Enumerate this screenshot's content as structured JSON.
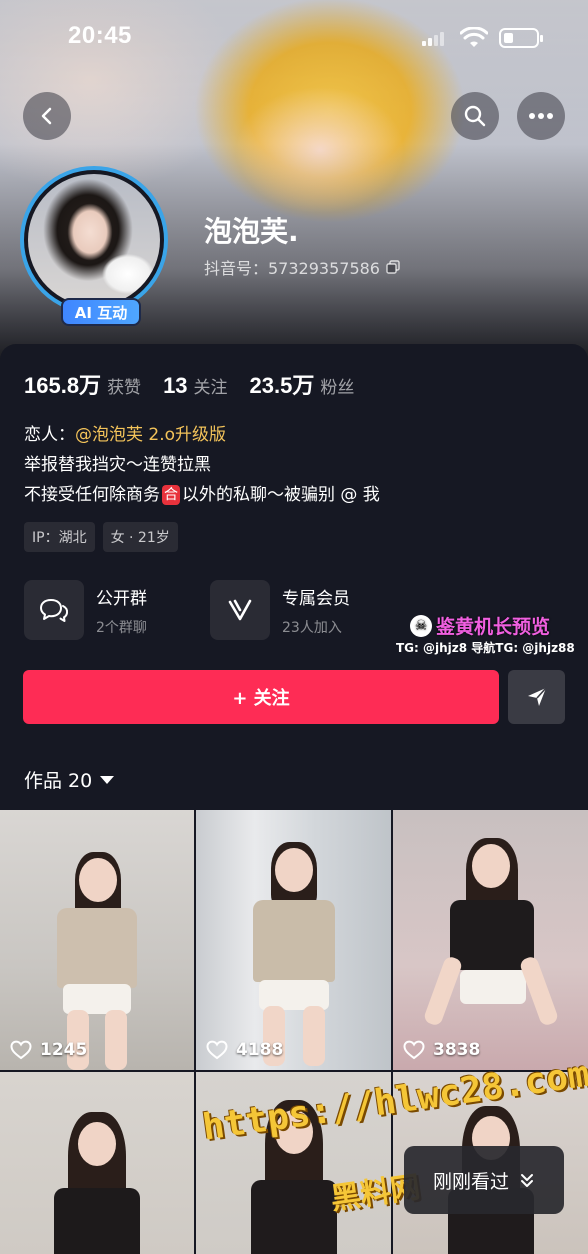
{
  "status_bar": {
    "time": "20:45"
  },
  "profile": {
    "nickname": "泡泡芙.",
    "douyin_id": "抖音号：57329357586",
    "ai_badge": "AI 互动"
  },
  "stats": [
    {
      "value": "165.8万",
      "label": "获赞"
    },
    {
      "value": "13",
      "label": "关注"
    },
    {
      "value": "23.5万",
      "label": "粉丝"
    }
  ],
  "bio": {
    "lover_label": "恋人：",
    "lover_mention": "@泡泡芙 2.o升级版",
    "line2": "举报替我挡灾～连赞拉黑",
    "line3_a": "不接受任何除商务",
    "line3_badge": "合",
    "line3_b": "以外的私聊～被骗别 @ 我"
  },
  "tags": [
    "IP：湖北",
    "女 · 21岁"
  ],
  "entries": [
    {
      "title": "公开群",
      "sub": "2个群聊",
      "icon": "chat-bubbles-icon"
    },
    {
      "title": "专属会员",
      "sub": "23人加入",
      "icon": "vip-v-icon"
    }
  ],
  "watermark": {
    "brand": "鉴黄机长预览",
    "tg": "TG: @jhjz8 导航TG: @jhjz88",
    "url": "https://hlwc28.com",
    "site": "黑料网"
  },
  "actions": {
    "follow": "+ 关注"
  },
  "works_tab": {
    "label": "作品 20"
  },
  "videos": [
    {
      "likes": "1245"
    },
    {
      "likes": "4188"
    },
    {
      "likes": "3838"
    }
  ],
  "recent_pill": {
    "label": "刚刚看过"
  },
  "colors": {
    "follow": "#fe2c55",
    "mention": "#f3c35a",
    "ai_badge": "#3f86ff",
    "avatar_ring": "#3aa4e8"
  }
}
